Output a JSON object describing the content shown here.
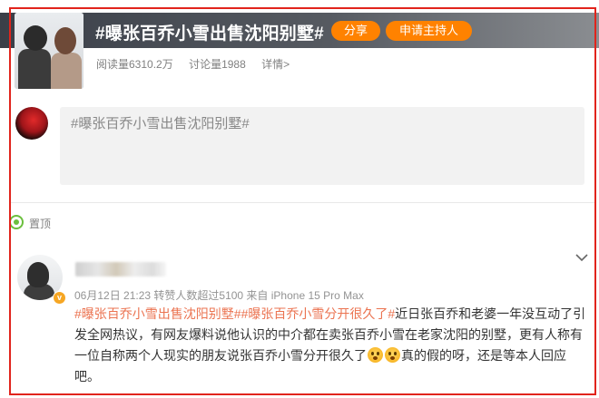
{
  "topic": {
    "title": "#曝张百乔小雪出售沈阳别墅#",
    "share_label": "分享",
    "host_label": "申请主持人",
    "reads": "阅读量6310.2万",
    "discussions": "讨论量1988",
    "details": "详情>"
  },
  "compose": {
    "placeholder": "#曝张百乔小雪出售沈阳别墅#"
  },
  "pinned": {
    "label": "置顶"
  },
  "post": {
    "meta": "06月12日 21:23 转赞人数超过5100  来自 iPhone 15 Pro Max",
    "tag1": "#曝张百乔小雪出售沈阳别墅#",
    "tag2": "#曝张百乔小雪分开很久了#",
    "text1": "近日张百乔和老婆一年没互动了引发全网热议，有网友爆料说他认识的中介都在卖张百乔小雪在老家沈阳的别墅，更有人称有一位自称两个人现实的朋友说张百乔小雪分开很久了",
    "text2": "真的假的呀，还是等本人回应吧。",
    "vbadge": "v"
  },
  "colors": {
    "accent": "#ff8200",
    "tag": "#eb7350",
    "frame": "#e1241c",
    "pinned": "#6bbf3e"
  },
  "icons": [
    "chevron-down-icon",
    "pinned-icon",
    "emoji-icon"
  ]
}
